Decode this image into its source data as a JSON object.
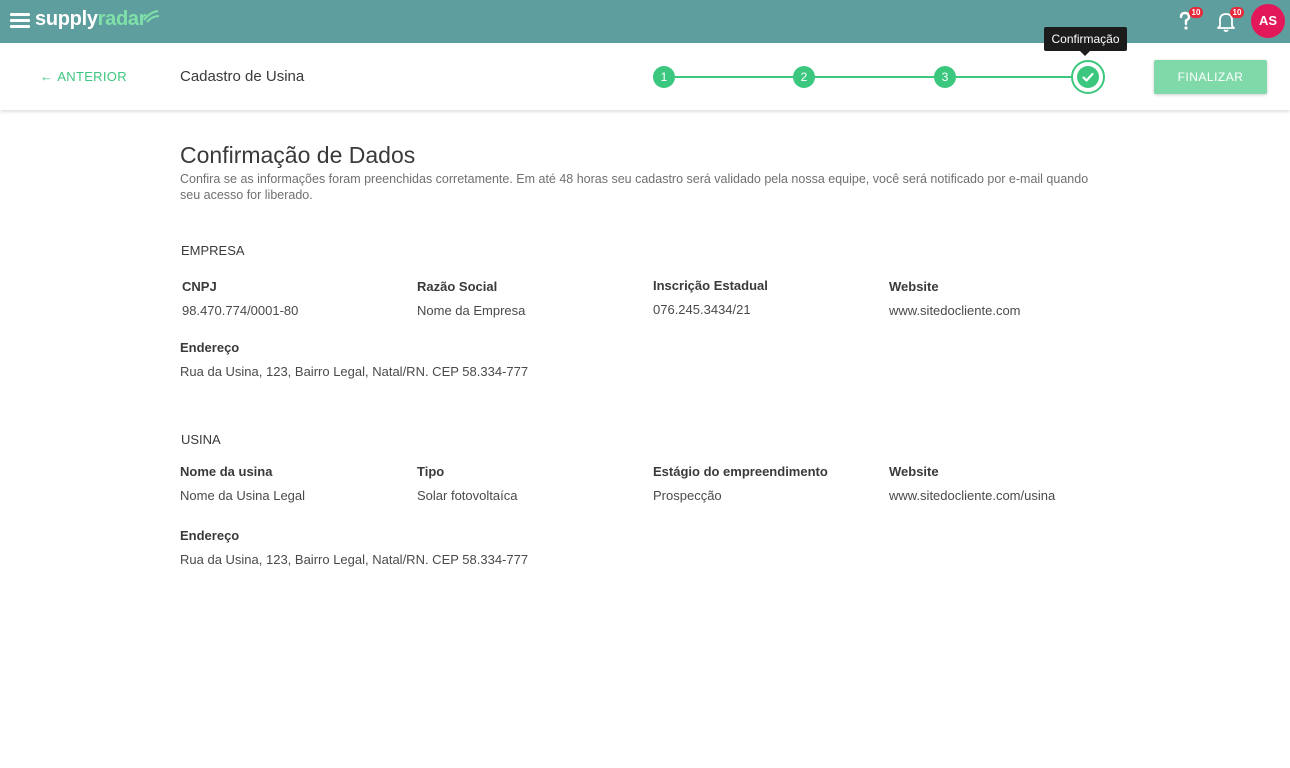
{
  "appbar": {
    "logo_supply": "supply",
    "logo_radar": "radar",
    "menu_icon": "hamburger-menu-icon",
    "help_badge": "10",
    "notifications_badge": "10",
    "avatar_initials": "AS",
    "colors": {
      "bar": "#5f9e9e",
      "accent": "#3cc77f",
      "avatar": "#e2185a",
      "badge": "#e8293a"
    }
  },
  "subheader": {
    "back_label": "ANTERIOR",
    "title": "Cadastro de Usina",
    "steps": [
      "1",
      "2",
      "3"
    ],
    "current_step_tooltip": "Confirmação",
    "finalize_label": "FINALIZAR"
  },
  "content": {
    "heading": "Confirmação de Dados",
    "intro": "Confira se as informações foram preenchidas corretamente. Em até 48 horas seu cadastro será validado pela nossa equipe, você será notificado por e-mail quando seu acesso for liberado.",
    "empresa": {
      "title": "EMPRESA",
      "cnpj_label": "CNPJ",
      "cnpj_value": "98.470.774/0001-80",
      "razao_label": "Razão Social",
      "razao_value": "Nome da Empresa",
      "ie_label": "Inscrição Estadual",
      "ie_value": "076.245.3434/21",
      "website_label": "Website",
      "website_value": "www.sitedocliente.com",
      "endereco_label": "Endereço",
      "endereco_value": "Rua da Usina, 123, Bairro Legal, Natal/RN. CEP 58.334-777"
    },
    "usina": {
      "title": "USINA",
      "nome_label": "Nome da usina",
      "nome_value": "Nome da Usina Legal",
      "tipo_label": "Tipo",
      "tipo_value": "Solar fotovoltaíca",
      "estagio_label": "Estágio do empreendimento",
      "estagio_value": "Prospecção",
      "website_label": "Website",
      "website_value": "www.sitedocliente.com/usina",
      "endereco_label": "Endereço",
      "endereco_value": "Rua da Usina, 123, Bairro Legal, Natal/RN. CEP 58.334-777"
    }
  }
}
